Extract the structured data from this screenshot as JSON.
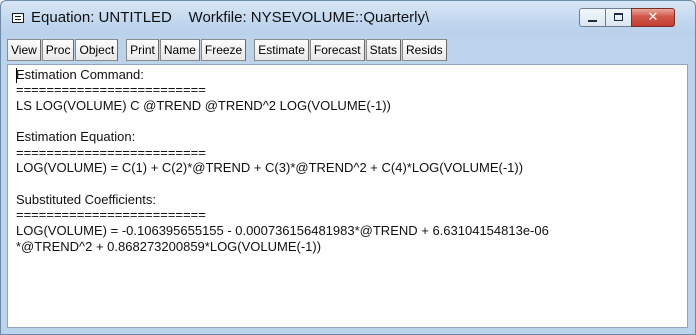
{
  "window": {
    "title": "Equation: UNTITLED    Workfile: NYSEVOLUME::Quarterly\\",
    "controls": {
      "minimize": "",
      "maximize": "",
      "close": "✕"
    }
  },
  "toolbar": {
    "group1": [
      "View",
      "Proc",
      "Object"
    ],
    "group2": [
      "Print",
      "Name",
      "Freeze"
    ],
    "group3": [
      "Estimate",
      "Forecast",
      "Stats",
      "Resids"
    ]
  },
  "content": {
    "lines": [
      "Estimation Command:",
      "=========================",
      "LS LOG(VOLUME) C @TREND @TREND^2 LOG(VOLUME(-1))",
      "",
      "Estimation Equation:",
      "=========================",
      "LOG(VOLUME) = C(1) + C(2)*@TREND + C(3)*@TREND^2 + C(4)*LOG(VOLUME(-1))",
      "",
      "Substituted Coefficients:",
      "=========================",
      "LOG(VOLUME) = -0.106395655155 - 0.000736156481983*@TREND + 6.63104154813e-06",
      "*@TREND^2 + 0.868273200859*LOG(VOLUME(-1))"
    ]
  }
}
